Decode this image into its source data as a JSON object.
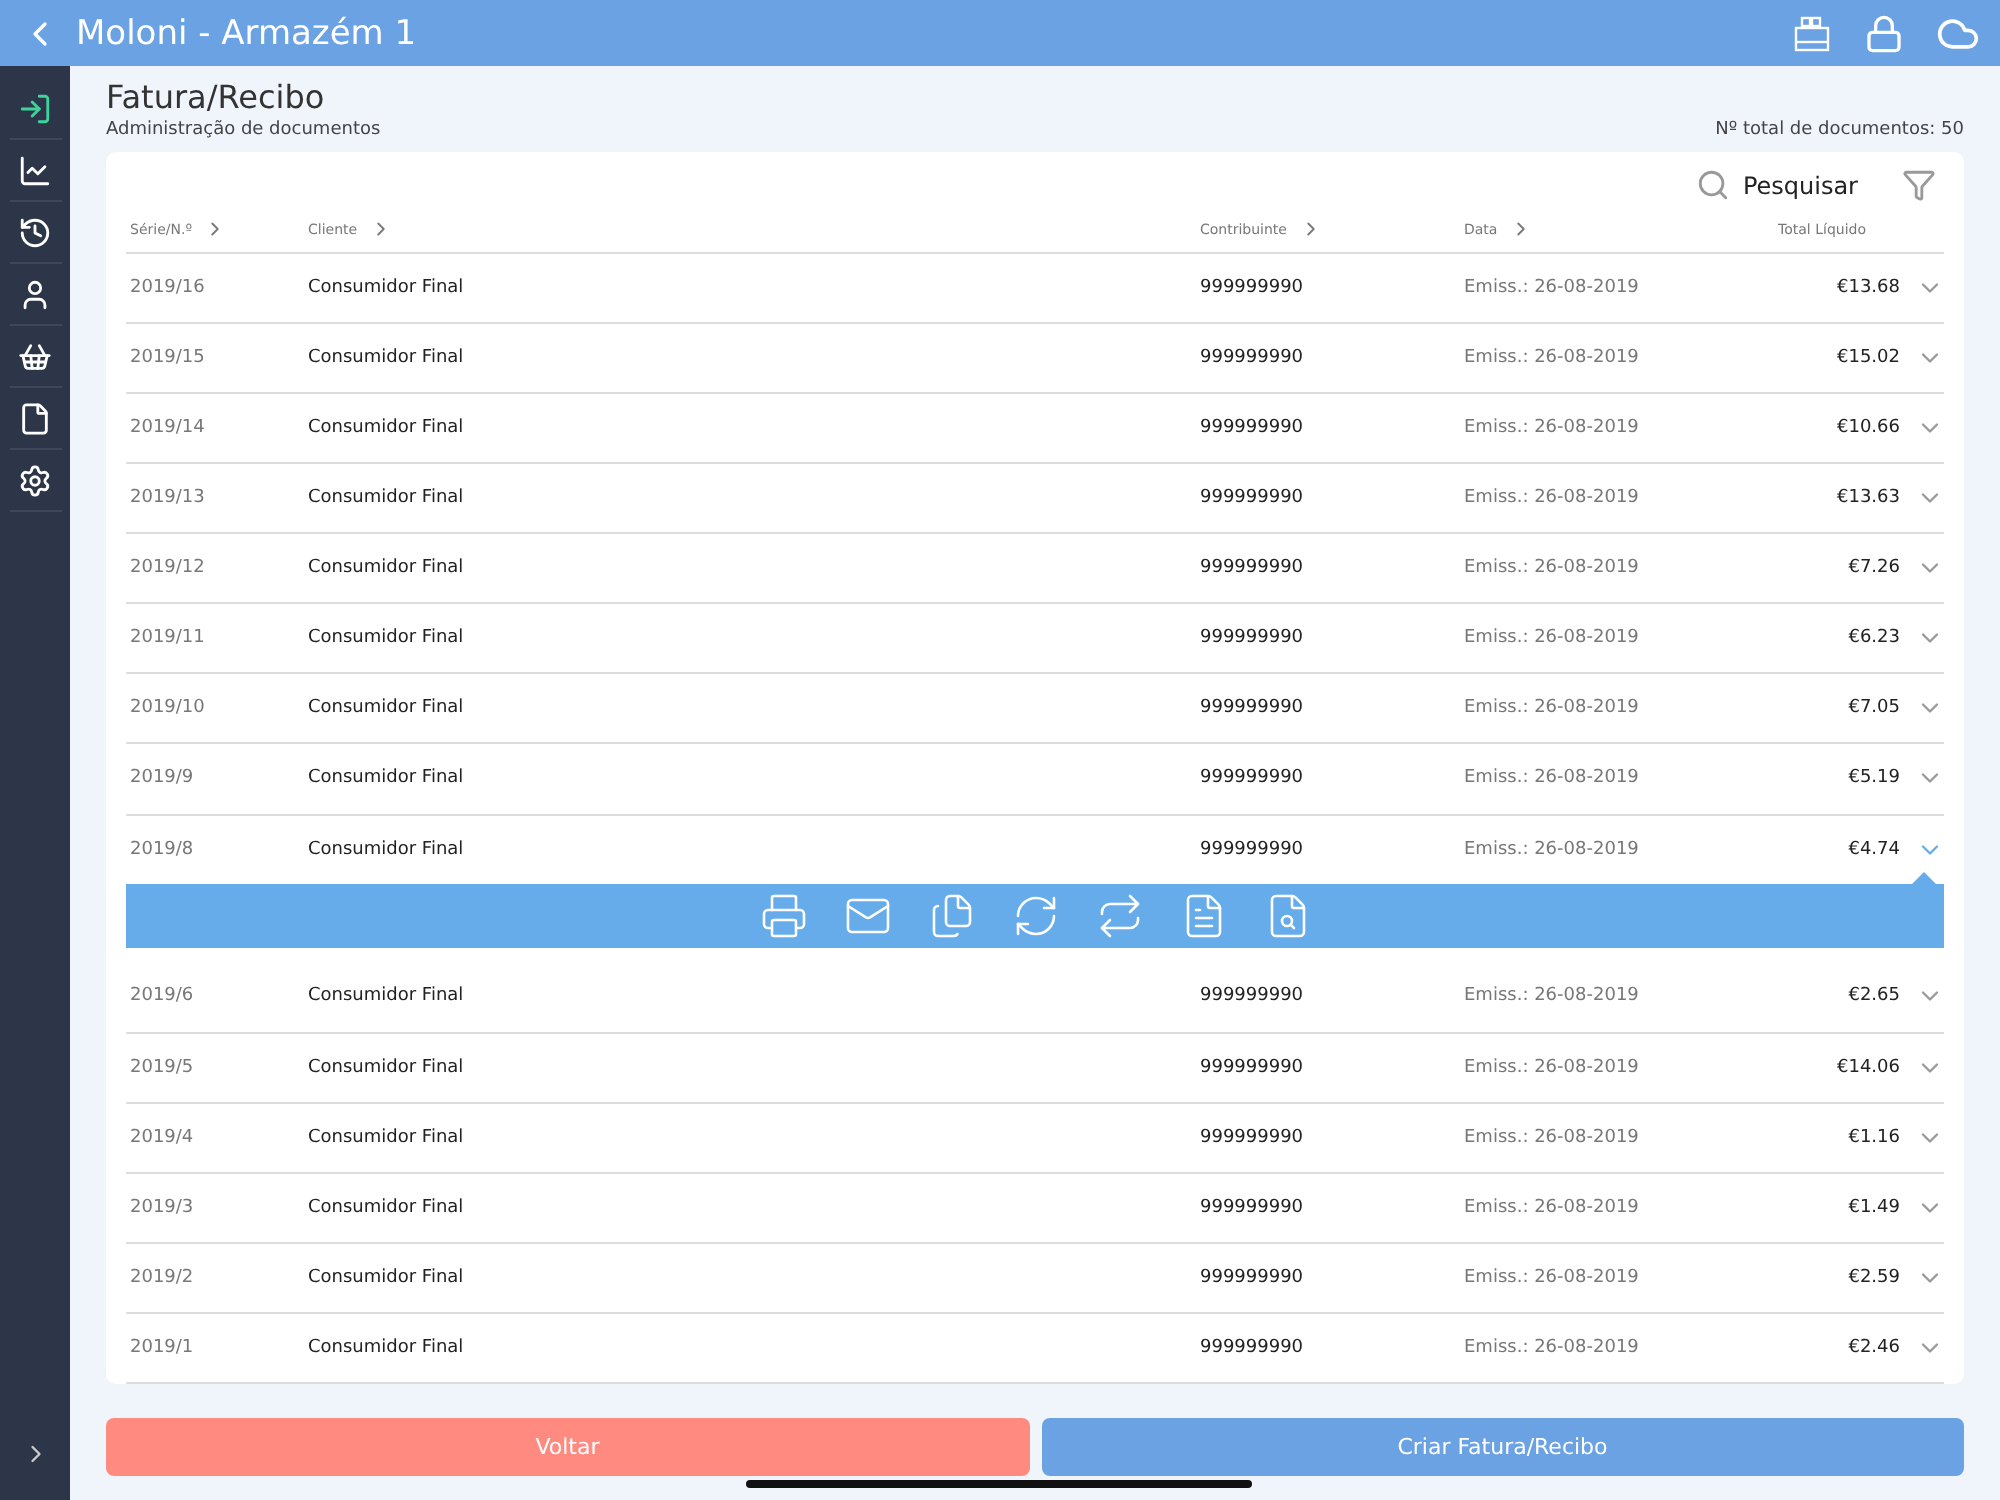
{
  "window": {
    "title": "Moloni - Armazém 1"
  },
  "sidebar": {
    "items": [
      {
        "selected": true
      },
      {
        "selected": false
      },
      {
        "selected": false
      },
      {
        "selected": false
      },
      {
        "selected": false
      },
      {
        "selected": false
      },
      {
        "selected": false
      }
    ]
  },
  "page": {
    "title": "Fatura/Recibo",
    "subtitle": "Administração de documentos",
    "total": "Nº total de documentos: 50"
  },
  "search": {
    "label": "Pesquisar"
  },
  "table": {
    "columns": [
      {
        "label": "Série/N.º",
        "sortable": true
      },
      {
        "label": "Cliente",
        "sortable": true
      },
      {
        "label": "Contribuinte",
        "sortable": true
      },
      {
        "label": "Data",
        "sortable": true
      },
      {
        "label": "Total Líquido",
        "sortable": false
      }
    ],
    "rows": [
      {
        "number": "2019/16",
        "client": "Consumidor Final",
        "tax_id": "999999990",
        "date": "Emiss.: 26-08-2019",
        "total": "€13.68",
        "expanded": false
      },
      {
        "number": "2019/15",
        "client": "Consumidor Final",
        "tax_id": "999999990",
        "date": "Emiss.: 26-08-2019",
        "total": "€15.02",
        "expanded": false
      },
      {
        "number": "2019/14",
        "client": "Consumidor Final",
        "tax_id": "999999990",
        "date": "Emiss.: 26-08-2019",
        "total": "€10.66",
        "expanded": false
      },
      {
        "number": "2019/13",
        "client": "Consumidor Final",
        "tax_id": "999999990",
        "date": "Emiss.: 26-08-2019",
        "total": "€13.63",
        "expanded": false
      },
      {
        "number": "2019/12",
        "client": "Consumidor Final",
        "tax_id": "999999990",
        "date": "Emiss.: 26-08-2019",
        "total": "€7.26",
        "expanded": false
      },
      {
        "number": "2019/11",
        "client": "Consumidor Final",
        "tax_id": "999999990",
        "date": "Emiss.: 26-08-2019",
        "total": "€6.23",
        "expanded": false
      },
      {
        "number": "2019/10",
        "client": "Consumidor Final",
        "tax_id": "999999990",
        "date": "Emiss.: 26-08-2019",
        "total": "€7.05",
        "expanded": false
      },
      {
        "number": "2019/9",
        "client": "Consumidor Final",
        "tax_id": "999999990",
        "date": "Emiss.: 26-08-2019",
        "total": "€5.19",
        "expanded": false
      },
      {
        "number": "2019/8",
        "client": "Consumidor Final",
        "tax_id": "999999990",
        "date": "Emiss.: 26-08-2019",
        "total": "€4.74",
        "expanded": true
      },
      {
        "number": "2019/6",
        "client": "Consumidor Final",
        "tax_id": "999999990",
        "date": "Emiss.: 26-08-2019",
        "total": "€2.65",
        "expanded": false
      },
      {
        "number": "2019/5",
        "client": "Consumidor Final",
        "tax_id": "999999990",
        "date": "Emiss.: 26-08-2019",
        "total": "€14.06",
        "expanded": false
      },
      {
        "number": "2019/4",
        "client": "Consumidor Final",
        "tax_id": "999999990",
        "date": "Emiss.: 26-08-2019",
        "total": "€1.16",
        "expanded": false
      },
      {
        "number": "2019/3",
        "client": "Consumidor Final",
        "tax_id": "999999990",
        "date": "Emiss.: 26-08-2019",
        "total": "€1.49",
        "expanded": false
      },
      {
        "number": "2019/2",
        "client": "Consumidor Final",
        "tax_id": "999999990",
        "date": "Emiss.: 26-08-2019",
        "total": "€2.59",
        "expanded": false
      },
      {
        "number": "2019/1",
        "client": "Consumidor Final",
        "tax_id": "999999990",
        "date": "Emiss.: 26-08-2019",
        "total": "€2.46",
        "expanded": false
      }
    ]
  },
  "buttons": [
    {
      "label": "Voltar",
      "kind": "secondary"
    },
    {
      "label": "Criar Fatura/Recibo",
      "kind": "primary"
    }
  ]
}
